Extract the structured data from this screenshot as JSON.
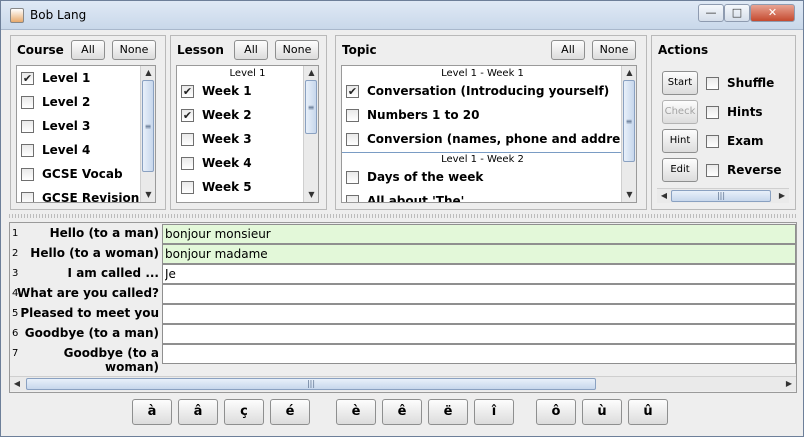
{
  "window": {
    "title": "Bob Lang",
    "minimize_label": "—",
    "maximize_label": "□",
    "close_label": "✕"
  },
  "course": {
    "title": "Course",
    "all_label": "All",
    "none_label": "None",
    "items": [
      {
        "label": "Level 1",
        "checked": true
      },
      {
        "label": "Level 2",
        "checked": false
      },
      {
        "label": "Level 3",
        "checked": false
      },
      {
        "label": "Level 4",
        "checked": false
      },
      {
        "label": "GCSE Vocab",
        "checked": false
      },
      {
        "label": "GCSE Revision",
        "checked": false
      }
    ]
  },
  "lesson": {
    "title": "Lesson",
    "all_label": "All",
    "none_label": "None",
    "group_header": "Level 1",
    "items": [
      {
        "label": "Week 1",
        "checked": true
      },
      {
        "label": "Week 2",
        "checked": true
      },
      {
        "label": "Week 3",
        "checked": false
      },
      {
        "label": "Week 4",
        "checked": false
      },
      {
        "label": "Week 5",
        "checked": false
      }
    ]
  },
  "topic": {
    "title": "Topic",
    "all_label": "All",
    "none_label": "None",
    "group1_header": "Level 1 - Week 1",
    "group2_header": "Level 1 - Week 2",
    "items": [
      {
        "label": "Conversation (Introducing yourself)",
        "checked": true
      },
      {
        "label": "Numbers 1 to 20",
        "checked": false
      },
      {
        "label": "Conversion (names, phone and address)",
        "checked": false
      },
      {
        "label": "Days of the week",
        "checked": false
      },
      {
        "label": "All about 'The'",
        "checked": false
      }
    ]
  },
  "actions": {
    "title": "Actions",
    "start_label": "Start",
    "check_label": "Check",
    "hint_label": "Hint",
    "edit_label": "Edit",
    "shuffle_label": "Shuffle",
    "hints_label": "Hints",
    "exam_label": "Exam",
    "reverse_label": "Reverse"
  },
  "phrases": [
    {
      "num": "1",
      "prompt": "Hello (to a man)",
      "answer": "bonjour monsieur",
      "done": true
    },
    {
      "num": "2",
      "prompt": "Hello (to a woman)",
      "answer": "bonjour madame",
      "done": true
    },
    {
      "num": "3",
      "prompt": "I am called ...",
      "answer": "Je",
      "done": false
    },
    {
      "num": "4",
      "prompt": "What are you called?",
      "answer": "",
      "done": false
    },
    {
      "num": "5",
      "prompt": "Pleased to meet you",
      "answer": "",
      "done": false
    },
    {
      "num": "6",
      "prompt": "Goodbye (to a man)",
      "answer": "",
      "done": false
    },
    {
      "num": "7",
      "prompt": "Goodbye (to a woman)",
      "answer": "",
      "done": false
    }
  ],
  "accents": [
    "à",
    "â",
    "ç",
    "é",
    "è",
    "ê",
    "ë",
    "î",
    "ô",
    "ù",
    "û"
  ],
  "colors": {
    "answered_field": "#e3f8d9",
    "window_bg": "#eeeeee"
  }
}
